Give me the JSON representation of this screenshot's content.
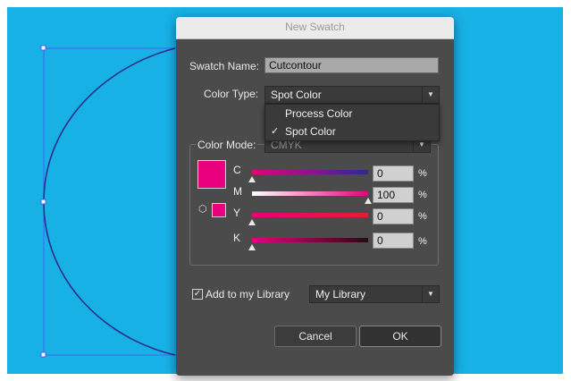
{
  "dialog": {
    "title": "New Swatch",
    "swatch_name_label": "Swatch Name:",
    "swatch_name_value": "Cutcontour",
    "color_type_label": "Color Type:",
    "color_type_value": "Spot Color",
    "color_type_options": [
      {
        "label": "Process Color",
        "checked": false
      },
      {
        "label": "Spot Color",
        "checked": true
      }
    ],
    "check_mark": "✓",
    "color_mode_label": "Color Mode:",
    "color_mode_value": "CMYK",
    "channels": [
      {
        "label": "C",
        "value": "0",
        "unit": "%"
      },
      {
        "label": "M",
        "value": "100",
        "unit": "%"
      },
      {
        "label": "Y",
        "value": "0",
        "unit": "%"
      },
      {
        "label": "K",
        "value": "0",
        "unit": "%"
      }
    ],
    "slider_levels": [
      0,
      1,
      0,
      0
    ],
    "swatch_color": "#e8007f",
    "add_to_library_label": "Add to my Library",
    "add_to_library_checked": true,
    "library_value": "My Library",
    "cancel_label": "Cancel",
    "ok_label": "OK"
  },
  "colors": {
    "canvas_background": "#17b1e6",
    "dialog_background": "#4b4b4b",
    "accent_magenta": "#e8007f"
  },
  "icons": {
    "dropdown": "chevron-down-icon",
    "check": "check-icon",
    "gamut": "cube-icon"
  }
}
